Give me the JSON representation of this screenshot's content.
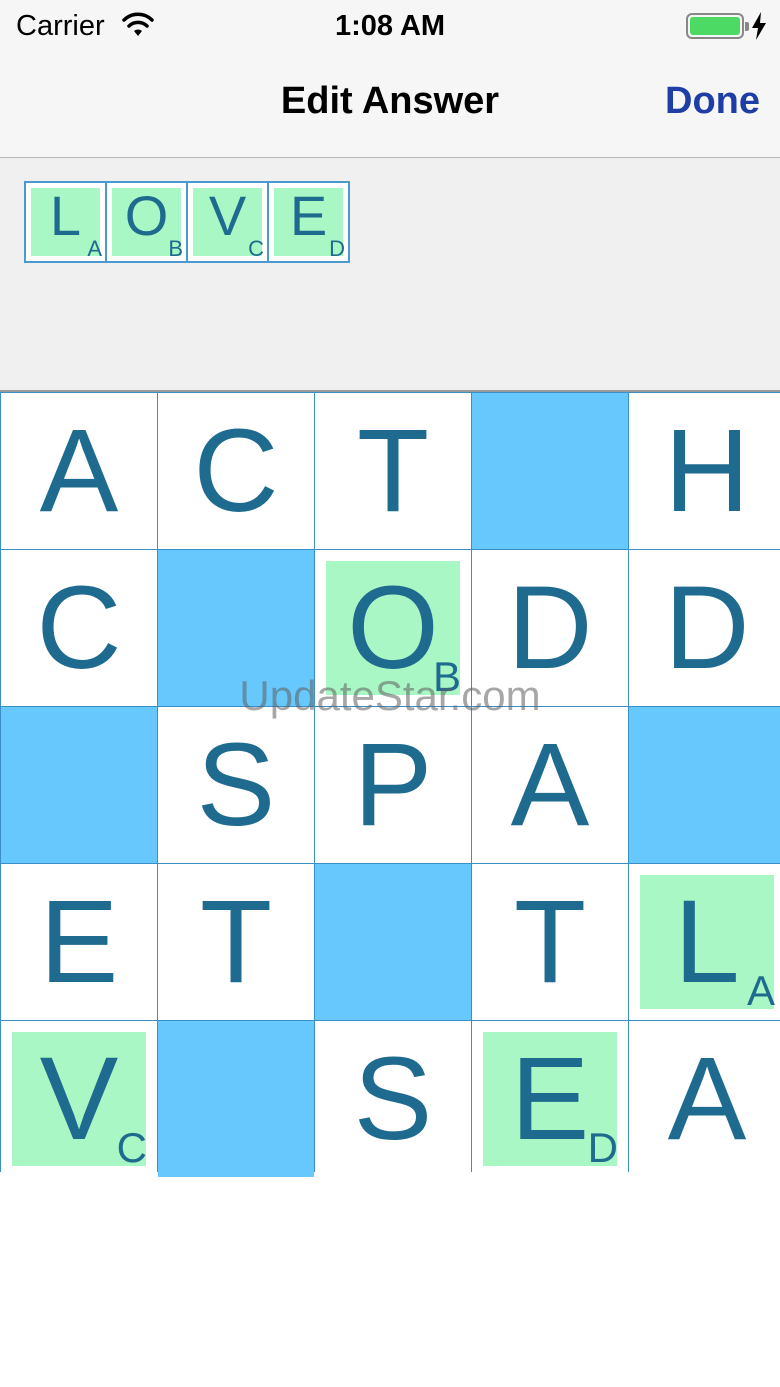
{
  "status_bar": {
    "carrier": "Carrier",
    "time": "1:08 AM",
    "wifi_icon": "wifi-icon",
    "battery_icon": "battery-icon",
    "charging_icon": "charging-bolt-icon",
    "battery_level": 1.0
  },
  "nav": {
    "title": "Edit Answer",
    "done_label": "Done"
  },
  "answer": {
    "tiles": [
      {
        "letter": "L",
        "sub": "A"
      },
      {
        "letter": "O",
        "sub": "B"
      },
      {
        "letter": "V",
        "sub": "C"
      },
      {
        "letter": "E",
        "sub": "D"
      }
    ]
  },
  "grid": {
    "rows": [
      [
        {
          "letter": "A"
        },
        {
          "letter": "C"
        },
        {
          "letter": "T"
        },
        {
          "blank": true
        },
        {
          "letter": "H"
        }
      ],
      [
        {
          "letter": "C"
        },
        {
          "blank": true
        },
        {
          "letter": "O",
          "sub": "B",
          "highlight": true
        },
        {
          "letter": "D"
        },
        {
          "letter": "D"
        }
      ],
      [
        {
          "blank": true
        },
        {
          "letter": "S"
        },
        {
          "letter": "P"
        },
        {
          "letter": "A"
        },
        {
          "blank": true
        }
      ],
      [
        {
          "letter": "E"
        },
        {
          "letter": "T"
        },
        {
          "blank": true
        },
        {
          "letter": "T"
        },
        {
          "letter": "L",
          "sub": "A",
          "highlight": true
        }
      ],
      [
        {
          "letter": "V",
          "sub": "C",
          "highlight": true
        },
        {
          "blank": true
        },
        {
          "letter": "S"
        },
        {
          "letter": "E",
          "sub": "D",
          "highlight": true
        },
        {
          "letter": "A"
        }
      ]
    ]
  },
  "watermark": "UpdateStar.com",
  "colors": {
    "letter": "#1f6b8f",
    "blank_cell": "#66c8fd",
    "highlight": "#a9f7c5",
    "grid_line": "#3b8fc7",
    "done": "#1e3ea6",
    "battery": "#4cd964"
  }
}
